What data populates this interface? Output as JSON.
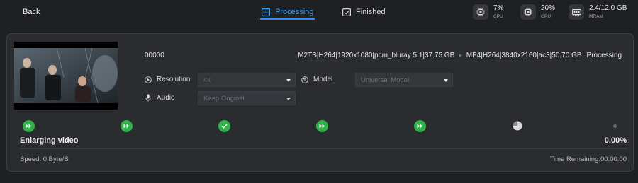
{
  "topbar": {
    "back_label": "Back",
    "tabs": [
      {
        "label": "Processing",
        "icon": "processing-icon",
        "active": true
      },
      {
        "label": "Finished",
        "icon": "finished-icon",
        "active": false
      }
    ],
    "stats": [
      {
        "value": "7%",
        "label": "CPU",
        "icon": "cpu-chip-icon"
      },
      {
        "value": "20%",
        "label": "GPU",
        "icon": "gpu-chip-icon"
      },
      {
        "value": "2.4/12.0 GB",
        "label": "MRAM",
        "icon": "memory-icon"
      }
    ]
  },
  "task": {
    "file_name": "00000",
    "source_format": "M2TS|H264|1920x1080|pcm_bluray 5.1|37.75 GB",
    "target_format": "MP4|H264|3840x2160|ac3|50.70 GB",
    "status": "Processing",
    "resolution_label": "Resolution",
    "resolution_value": "4k",
    "model_label": "Model",
    "model_value": "Universal Model",
    "audio_label": "Audio",
    "audio_value": "Keep Original",
    "stage_label": "Enlarging video",
    "progress_text": "0.00%",
    "progress_fraction": 0.0,
    "speed_text": "Speed: 0 Byte/S",
    "time_remaining_text": "Time Remaining:00:00:00"
  },
  "colors": {
    "accent": "#2f8ff0",
    "step_green": "#2fb24a",
    "background": "#1f2023",
    "card": "#2b2c30"
  }
}
